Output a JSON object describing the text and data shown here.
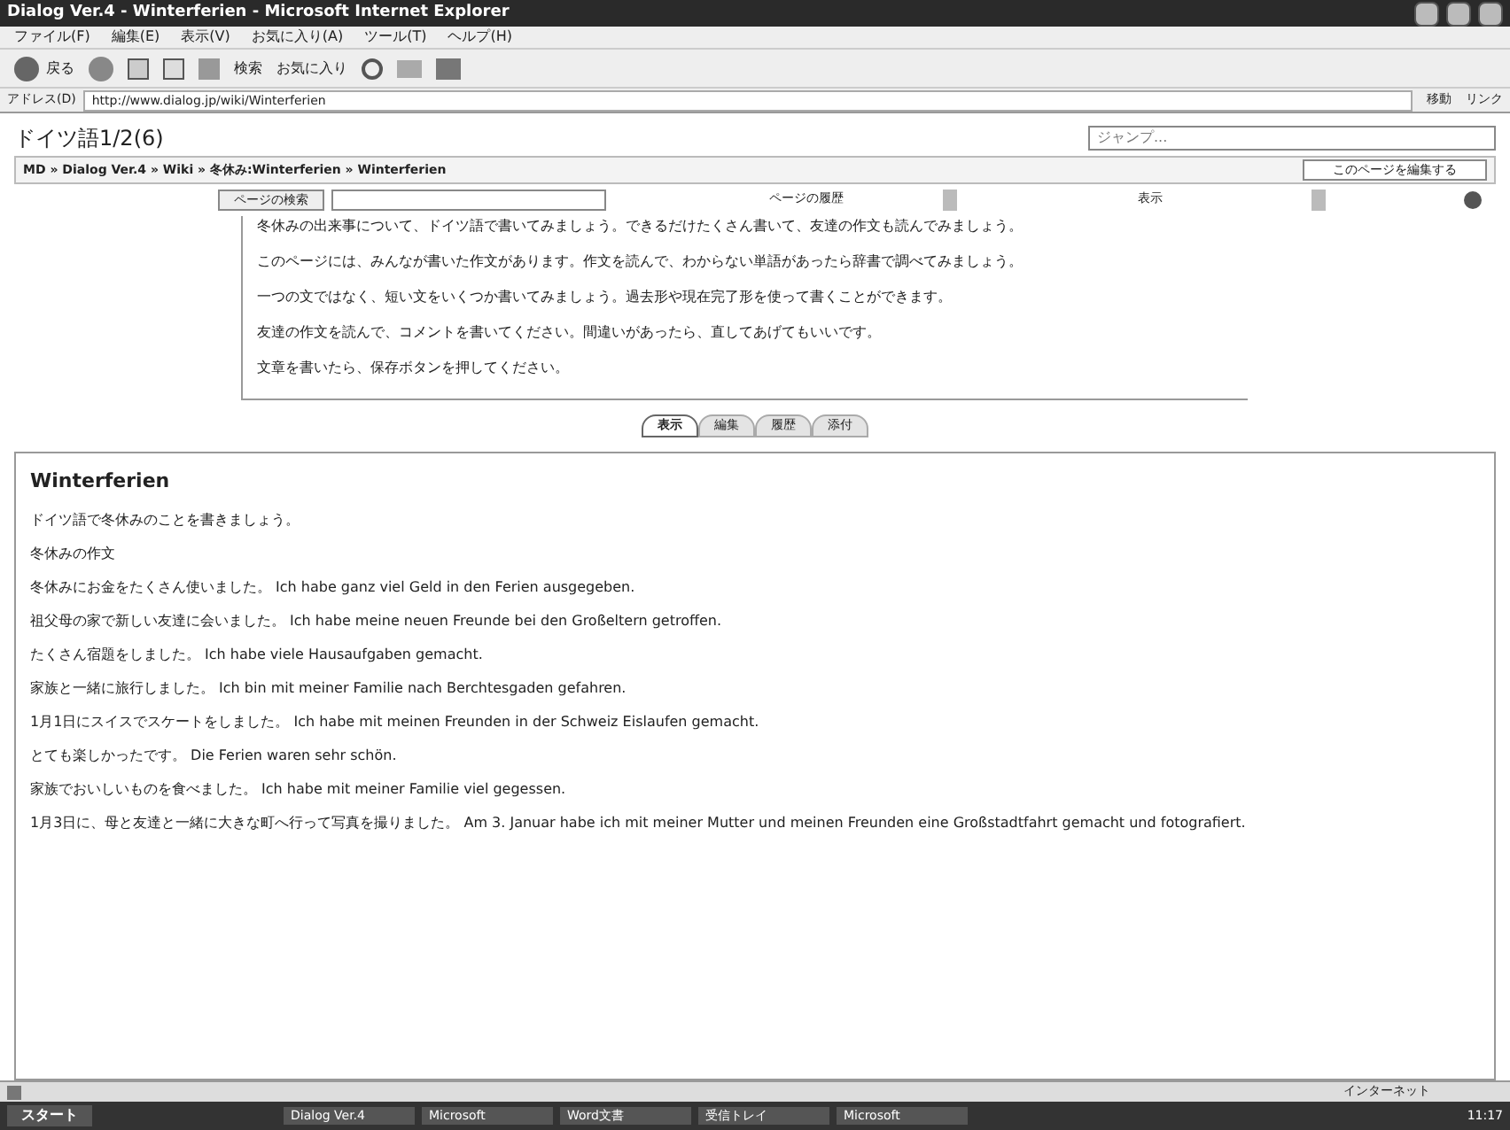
{
  "window": {
    "title": "Dialog Ver.4 - Winterferien - Microsoft Internet Explorer"
  },
  "menu": [
    "ファイル(F)",
    "編集(E)",
    "表示(V)",
    "お気に入り(A)",
    "ツール(T)",
    "ヘルプ(H)"
  ],
  "toolbar": {
    "back": "戻る",
    "search": "検索",
    "favorites": "お気に入り"
  },
  "address": {
    "label": "アドレス(D)",
    "value": "http://www.dialog.jp/wiki/Winterferien",
    "go": "移動",
    "links": "リンク"
  },
  "page": {
    "title": "ドイツ語1/2(6)",
    "jump_placeholder": "ジャンプ...",
    "breadcrumb": "MD » Dialog Ver.4 » Wiki » 冬休み:Winterferien » Winterferien",
    "edit_button": "このページを編集する",
    "search_button": "ページの検索",
    "history_select": "ページの履歴",
    "view_select": "表示",
    "paragraphs": [
      "冬休みの出来事について、ドイツ語で書いてみましょう。できるだけたくさん書いて、友達の作文も読んでみましょう。",
      "このページには、みんなが書いた作文があります。作文を読んで、わからない単語があったら辞書で調べてみましょう。",
      "一つの文ではなく、短い文をいくつか書いてみましょう。過去形や現在完了形を使って書くことができます。",
      "友達の作文を読んで、コメントを書いてください。間違いがあったら、直してあげてもいいです。",
      "文章を書いたら、保存ボタンを押してください。"
    ],
    "tabs": [
      {
        "label": "表示",
        "selected": true
      },
      {
        "label": "編集",
        "selected": false
      },
      {
        "label": "履歴",
        "selected": false
      },
      {
        "label": "添付",
        "selected": false
      }
    ]
  },
  "article": {
    "heading": "Winterferien",
    "lines": [
      "ドイツ語で冬休みのことを書きましょう。",
      "冬休みの作文",
      "冬休みにお金をたくさん使いました。 Ich habe ganz viel Geld in den Ferien ausgegeben.",
      "祖父母の家で新しい友達に会いました。 Ich habe meine neuen Freunde bei den Großeltern getroffen.",
      "たくさん宿題をしました。 Ich habe viele Hausaufgaben gemacht.",
      "家族と一緒に旅行しました。 Ich bin mit meiner Familie nach Berchtesgaden gefahren.",
      "1月1日にスイスでスケートをしました。 Ich habe mit meinen Freunden in der Schweiz Eislaufen gemacht.",
      "とても楽しかったです。 Die Ferien waren sehr schön.",
      "家族でおいしいものを食べました。 Ich habe mit meiner Familie viel gegessen.",
      "1月3日に、母と友達と一緒に大きな町へ行って写真を撮りました。 Am 3. Januar habe ich mit meiner Mutter und meinen Freunden eine Großstadtfahrt gemacht und fotografiert."
    ]
  },
  "status_bar": {
    "zone": "インターネット"
  },
  "taskbar": {
    "start": "スタート",
    "tasks": [
      "Dialog Ver.4",
      "Microsoft",
      "Word文書",
      "受信トレイ",
      "Microsoft"
    ],
    "clock": "11:17"
  }
}
